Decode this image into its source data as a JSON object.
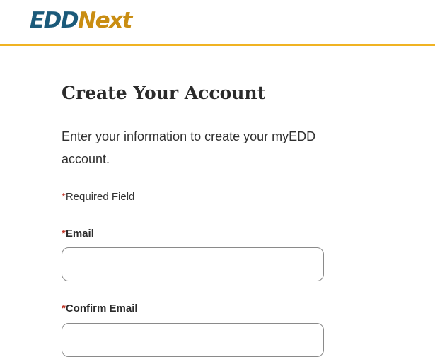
{
  "brand": {
    "logo_part1": "EDD",
    "logo_part2": "Next"
  },
  "colors": {
    "header_rule": "#f0b323",
    "brand_blue": "#1b5a7a",
    "brand_gold": "#c98d12",
    "required_asterisk": "#c0392b"
  },
  "page": {
    "title": "Create Your Account",
    "intro": "Enter your information to create your myEDD account.",
    "required_marker": "*",
    "required_note": "Required Field"
  },
  "form": {
    "email_label": "Email",
    "email_value": "",
    "confirm_email_label": "Confirm Email",
    "confirm_email_value": ""
  }
}
